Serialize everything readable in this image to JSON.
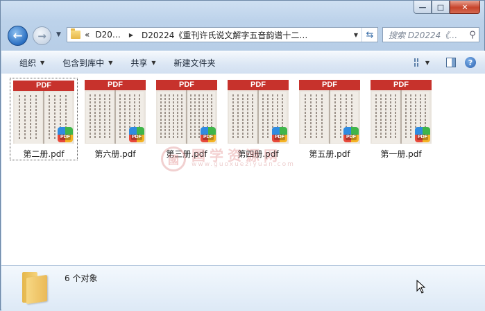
{
  "window": {
    "caption_buttons": {
      "minimize": "—",
      "maximize": "□",
      "close": "✕"
    }
  },
  "nav": {
    "back_icon": "arrow-left-icon",
    "forward_icon": "arrow-right-icon",
    "address": {
      "chevrons": "«",
      "crumb1": "D20…",
      "crumb2": "D20224《重刊许氏说文解字五音韵谱十二…"
    },
    "search_placeholder": "搜索 D20224《…"
  },
  "toolbar": {
    "organize": "组织",
    "include_in_library": "包含到库中",
    "share": "共享",
    "new_folder": "新建文件夹"
  },
  "files": [
    {
      "name": "第二册.pdf",
      "badge": "PDF",
      "selected": true
    },
    {
      "name": "第六册.pdf",
      "badge": "PDF",
      "selected": false
    },
    {
      "name": "第三册.pdf",
      "badge": "PDF",
      "selected": false
    },
    {
      "name": "第四册.pdf",
      "badge": "PDF",
      "selected": false
    },
    {
      "name": "第五册.pdf",
      "badge": "PDF",
      "selected": false
    },
    {
      "name": "第一册.pdf",
      "badge": "PDF",
      "selected": false
    }
  ],
  "app_badge_text": "PDF",
  "watermark": {
    "seal": "國",
    "title": "国学资源网",
    "url": "www.guoxueziyuan.com"
  },
  "details": {
    "count_text": "6 个对象"
  },
  "colors": {
    "pdf_band": "#c7322c",
    "toolbar_bg": "#dbe6f4",
    "window_frame": "#bcd3ea",
    "close_button": "#c7432a"
  }
}
